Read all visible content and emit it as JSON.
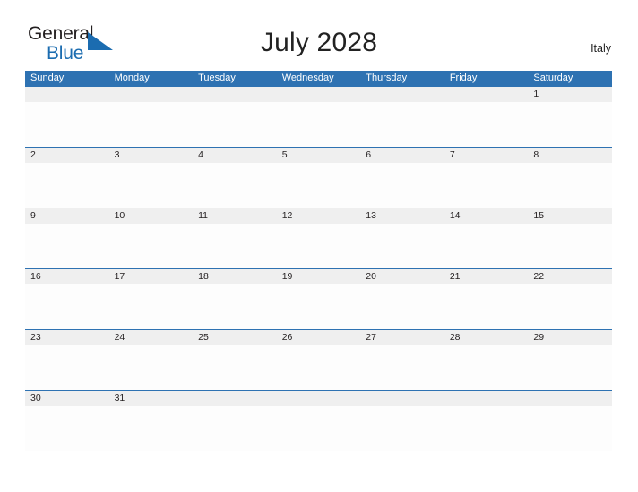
{
  "brand": {
    "name_part1": "General",
    "name_part2": "Blue",
    "flag_icon": "blue-flag-triangle-icon",
    "color_dark": "#231f20",
    "color_blue": "#1b6cb0"
  },
  "header": {
    "title": "July 2028",
    "region": "Italy"
  },
  "colors": {
    "header_blue": "#2e72b2",
    "date_strip_gray": "#efefef",
    "cell_white": "#fdfdfd",
    "text_dark": "#231f20"
  },
  "calendar": {
    "month": "July",
    "year": "2028",
    "weekdays": [
      "Sunday",
      "Monday",
      "Tuesday",
      "Wednesday",
      "Thursday",
      "Friday",
      "Saturday"
    ],
    "weeks": [
      [
        "",
        "",
        "",
        "",
        "",
        "",
        "1"
      ],
      [
        "2",
        "3",
        "4",
        "5",
        "6",
        "7",
        "8"
      ],
      [
        "9",
        "10",
        "11",
        "12",
        "13",
        "14",
        "15"
      ],
      [
        "16",
        "17",
        "18",
        "19",
        "20",
        "21",
        "22"
      ],
      [
        "23",
        "24",
        "25",
        "26",
        "27",
        "28",
        "29"
      ],
      [
        "30",
        "31",
        "",
        "",
        "",
        "",
        ""
      ]
    ]
  }
}
